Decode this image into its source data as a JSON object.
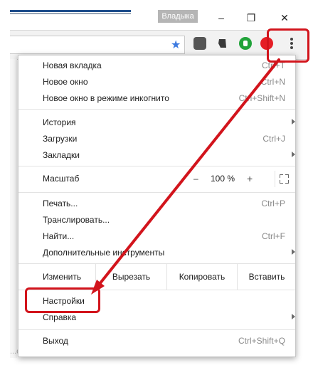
{
  "window": {
    "user_badge": "Владыка",
    "minimize": "–",
    "maximize": "❐",
    "close": "✕"
  },
  "toolbar": {
    "bookmark_icon": "star-icon",
    "menu_icon": "three-dots-icon"
  },
  "menu": {
    "new_tab": {
      "label": "Новая вкладка",
      "shortcut": "Ctrl+T"
    },
    "new_window": {
      "label": "Новое окно",
      "shortcut": "Ctrl+N"
    },
    "incognito": {
      "label": "Новое окно в режиме инкогнито",
      "shortcut": "Ctrl+Shift+N"
    },
    "history": {
      "label": "История"
    },
    "downloads": {
      "label": "Загрузки",
      "shortcut": "Ctrl+J"
    },
    "bookmarks": {
      "label": "Закладки"
    },
    "zoom": {
      "label": "Масштаб",
      "minus": "–",
      "value": "100 %",
      "plus": "+"
    },
    "print": {
      "label": "Печать...",
      "shortcut": "Ctrl+P"
    },
    "cast": {
      "label": "Транслировать..."
    },
    "find": {
      "label": "Найти...",
      "shortcut": "Ctrl+F"
    },
    "more_tools": {
      "label": "Дополнительные инструменты"
    },
    "edit": {
      "label": "Изменить",
      "cut": "Вырезать",
      "copy": "Копировать",
      "paste": "Вставить"
    },
    "settings": {
      "label": "Настройки"
    },
    "help": {
      "label": "Справка"
    },
    "exit": {
      "label": "Выход",
      "shortcut": "Ctrl+Shift+Q"
    }
  },
  "page": {
    "bottom_fragment": "...ейти"
  },
  "colors": {
    "annotation": "#d2141c",
    "accent_blue": "#3d7ae0"
  }
}
